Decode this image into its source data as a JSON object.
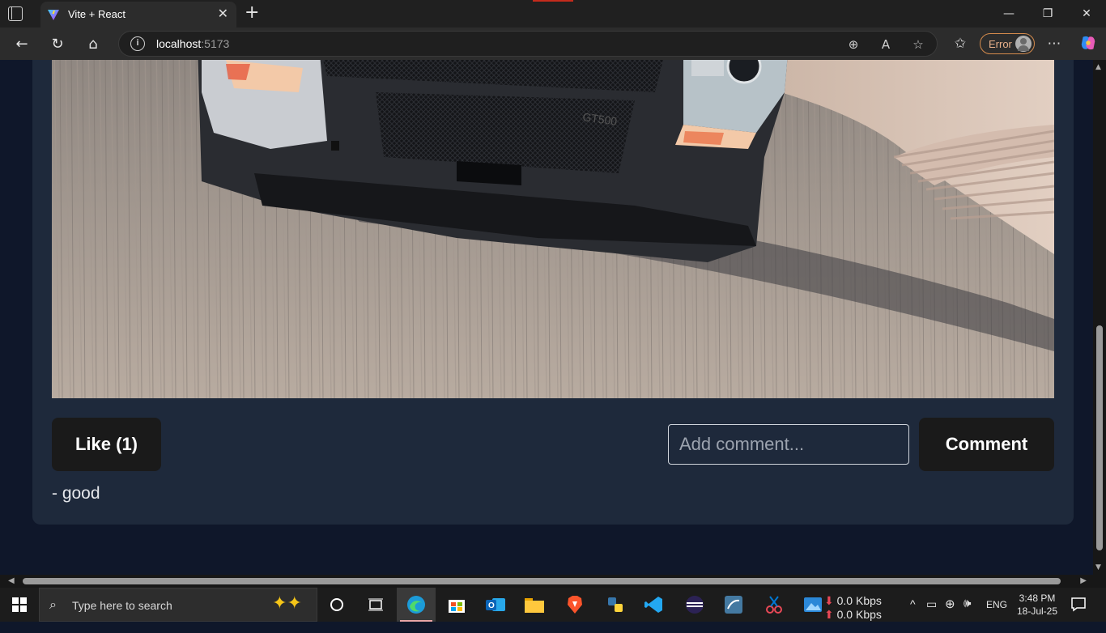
{
  "browser": {
    "tab_title": "Vite + React",
    "url_host": "localhost",
    "url_port": ":5173",
    "profile_status": "Error"
  },
  "post": {
    "like_label": "Like (1)",
    "comment_placeholder": "Add comment...",
    "comment_button_label": "Comment",
    "comments": [
      "- good"
    ]
  },
  "taskbar": {
    "search_placeholder": "Type here to search",
    "net_down": "0.0 Kbps",
    "net_up": "0.0 Kbps",
    "language": "ENG",
    "time": "3:48 PM",
    "date": "18-Jul-25"
  },
  "colors": {
    "page_bg": "#0f172a",
    "card_bg": "#1e293b",
    "button_bg": "#1a1a1a",
    "error_accent": "#d38a4c"
  }
}
